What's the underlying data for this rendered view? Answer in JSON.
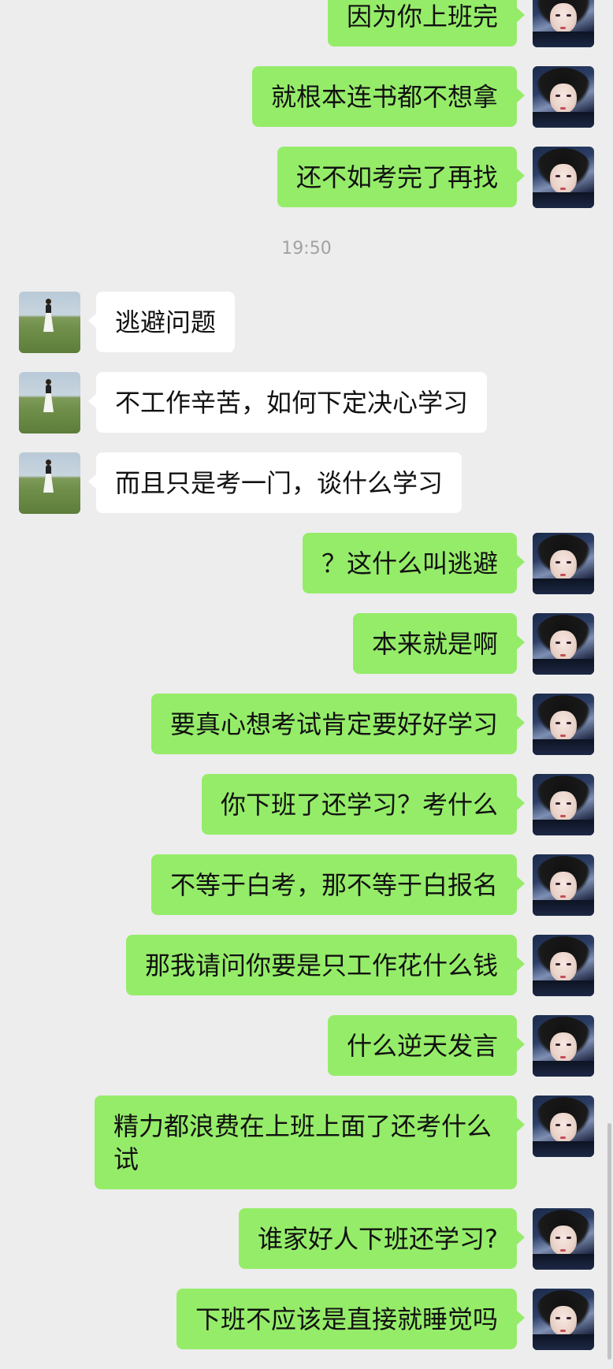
{
  "conversation": {
    "messages": [
      {
        "side": "me",
        "text": "因为你上班完"
      },
      {
        "side": "me",
        "text": "就根本连书都不想拿"
      },
      {
        "side": "me",
        "text": "还不如考完了再找"
      },
      {
        "type": "time",
        "text": "19:50"
      },
      {
        "side": "other",
        "text": "逃避问题"
      },
      {
        "side": "other",
        "text": "不工作辛苦，如何下定决心学习"
      },
      {
        "side": "other",
        "text": "而且只是考一门，谈什么学习"
      },
      {
        "side": "me",
        "text": "？这什么叫逃避"
      },
      {
        "side": "me",
        "text": "本来就是啊"
      },
      {
        "side": "me",
        "text": "要真心想考试肯定要好好学习"
      },
      {
        "side": "me",
        "text": "你下班了还学习？考什么"
      },
      {
        "side": "me",
        "text": "不等于白考，那不等于白报名"
      },
      {
        "side": "me",
        "text": "那我请问你要是只工作花什么钱"
      },
      {
        "side": "me",
        "text": "什么逆天发言"
      },
      {
        "side": "me",
        "text": "精力都浪费在上班上面了还考什么试"
      },
      {
        "side": "me",
        "text": "谁家好人下班还学习?"
      },
      {
        "side": "me",
        "text": "下班不应该是直接就睡觉吗"
      }
    ]
  },
  "colors": {
    "background": "#ededed",
    "my_bubble": "#95ec69",
    "other_bubble": "#ffffff",
    "timestamp": "#a2a2a2"
  },
  "icons": {
    "my_avatar": "anime-boy-avatar",
    "other_avatar": "grassland-girl-avatar"
  }
}
